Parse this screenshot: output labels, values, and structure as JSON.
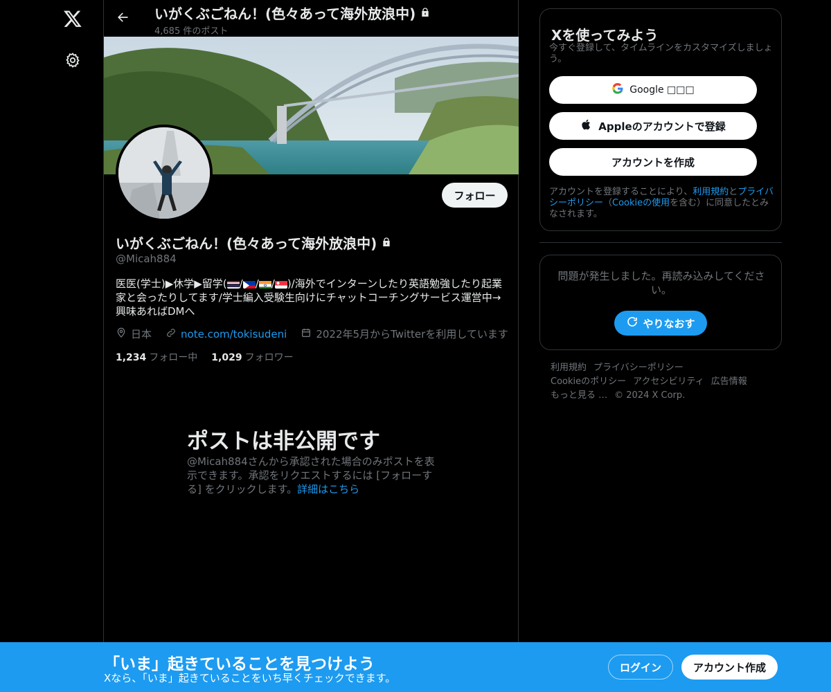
{
  "nav": {
    "logo_icon": "x-logo-icon",
    "settings_icon": "gear-icon"
  },
  "header": {
    "title": "いがくぶごねん！(色々あって海外放浪中)",
    "post_count": "4,685 件のポスト"
  },
  "profile": {
    "name": "いがくぶごねん！(色々あって海外放浪中)",
    "handle": "@Micah884",
    "follow_label": "フォロー",
    "bio_part1": "医医(学士)▶休学▶留学(",
    "bio_sep": "/",
    "bio_part2": ")/海外でインターンしたり英語勉強したり起業家と会ったりしてます/学士編入受験生向けにチャットコーチングサービス運営中→興味あればDMへ",
    "location": "日本",
    "website": "note.com/tokisudeni",
    "joined": "2022年5月からTwitterを利用しています",
    "following_count": "1,234",
    "following_label": "フォロー中",
    "followers_count": "1,029",
    "followers_label": "フォロワー"
  },
  "private": {
    "title": "ポストは非公開です",
    "body": "@Micah884さんから承認された場合のみポストを表示できます。承認をリクエストするには [フォローする] をクリックします。",
    "link": "詳細はこちら"
  },
  "signup_card": {
    "title": "Xを使ってみよう",
    "subtitle": "今すぐ登録して、タイムラインをカスタマイズしましょう。",
    "google_label": "Google □□□",
    "apple_label": "Appleのアカウントで登録",
    "create_label": "アカウントを作成",
    "legal_1": "アカウントを登録することにより、",
    "legal_terms": "利用規約",
    "legal_2": "と",
    "legal_privacy": "プライバシーポリシー",
    "legal_3": "（",
    "legal_cookie": "Cookieの使用",
    "legal_4": "を含む）に同意したとみなされます。"
  },
  "error_card": {
    "message": "問題が発生しました。再読み込みしてください。",
    "retry_label": "やりなおす"
  },
  "footer": {
    "links": [
      "利用規約",
      "プライバシーポリシー",
      "Cookieのポリシー",
      "アクセシビリティ",
      "広告情報",
      "もっと見る …"
    ],
    "copyright": "© 2024 X Corp."
  },
  "bottom_bar": {
    "title": "「いま」起きていることを見つけよう",
    "subtitle": "Xなら、「いま」起きていることをいち早くチェックできます。",
    "login_label": "ログイン",
    "signup_label": "アカウント作成"
  },
  "colors": {
    "accent": "#1d9bf0",
    "muted": "#71767b",
    "border": "#2f3336"
  }
}
